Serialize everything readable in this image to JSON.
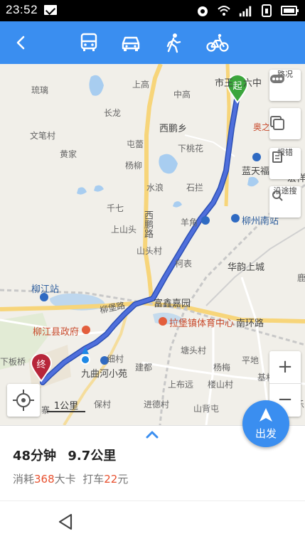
{
  "status": {
    "time": "23:52"
  },
  "nav": {
    "modes": [
      "bus",
      "car",
      "walk",
      "bike"
    ],
    "accent": "#3a8ef0"
  },
  "map": {
    "labels": {
      "liuli": "琉璃",
      "shanggao": "上高",
      "zhonggao": "中高",
      "shiwang": "市王",
      "liuzhong": "六中",
      "changlong": "长龙",
      "xipeng": "西鹏乡",
      "aozhixing": "奥之星",
      "guan": "馆",
      "wenbi": "文笔村",
      "huangjia": "黄家",
      "tunzhang": "屯蕾",
      "xiaxinghua": "下桃花",
      "yangliu": "杨柳",
      "lantian": "蓝天福园",
      "hongxiang": "宏祥",
      "shuilang": "水浪",
      "shilan": "石拦",
      "qiqi": "千七",
      "xipenglu": "西鹏路",
      "yangjiao": "羊角",
      "liuzhou_south": "柳州南站",
      "shangshantou": "上山头",
      "shantoucun": "山头村",
      "kebiao": "柯表",
      "huayun": "华韵上城",
      "liujiang_station": "柳江站",
      "liubao_rd": "柳堡路",
      "fuxin": "富鑫嘉园",
      "lu": "鹿",
      "liujiang_gov": "柳江县政府",
      "sports": "拉堡镇体育中心",
      "nanhuan": "南环路",
      "tangtou": "塘头村",
      "xiban": "下板桥",
      "xiban2": "细村",
      "pingdi": "平地",
      "jiuqu": "九曲河小苑",
      "jiande": "建都",
      "yangmei": "杨梅",
      "jicun": "基村",
      "baotian": "保村",
      "jinde": "进德村",
      "shangyuan": "上布远",
      "loushan": "楼山村",
      "shanbei": "山背屯",
      "xiaole": "小乐",
      "zhai": "寨",
      "start_pin": "起",
      "end_pin": "终"
    },
    "side_buttons": {
      "traffic": "路况",
      "report": "报错",
      "nearby": "沿途搜"
    },
    "zoom": {
      "plus": "+",
      "minus": "−"
    },
    "scale": "1公里",
    "go_label": "出发"
  },
  "route": {
    "duration": "48分钟",
    "distance": "9.7公里",
    "consume_prefix": "消耗",
    "calories": "368",
    "calories_unit": "大卡",
    "taxi_prefix": "打车",
    "taxi_price": "22",
    "taxi_unit": "元",
    "highlight_color": "#e8502e"
  }
}
